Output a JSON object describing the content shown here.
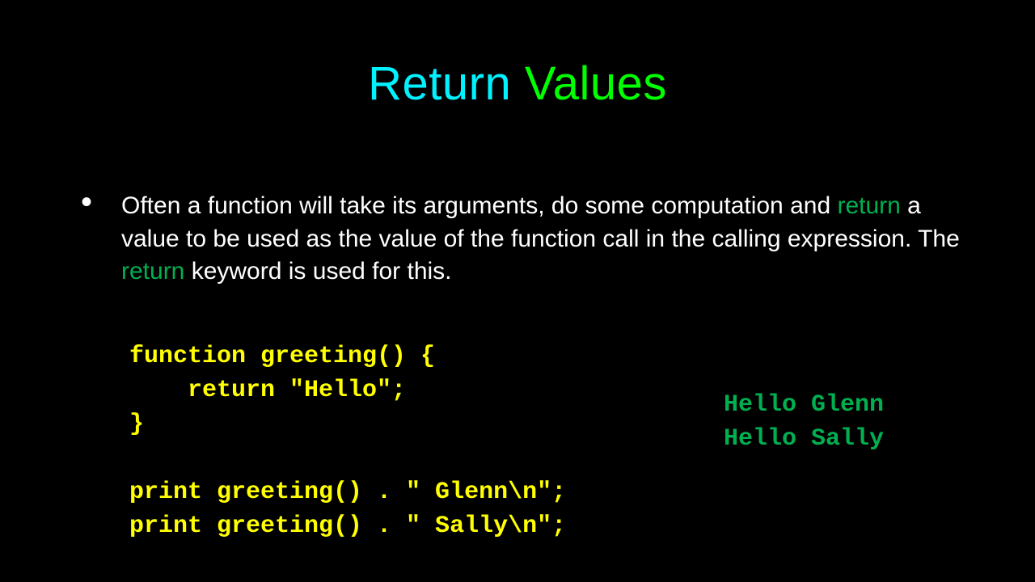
{
  "title": {
    "word1": "Return",
    "word2": "Values"
  },
  "paragraph": {
    "p1": "Often a function will take its arguments, do some computation and ",
    "kw1": "return",
    "p2": " a value to be used as the value of the function call in the calling expression.  The ",
    "kw2": "return",
    "p3": " keyword is used for this."
  },
  "code": "function greeting() {\n    return \"Hello\";\n}\n\nprint greeting() . \" Glenn\\n\";\nprint greeting() . \" Sally\\n\";",
  "output": "Hello Glenn\nHello Sally"
}
